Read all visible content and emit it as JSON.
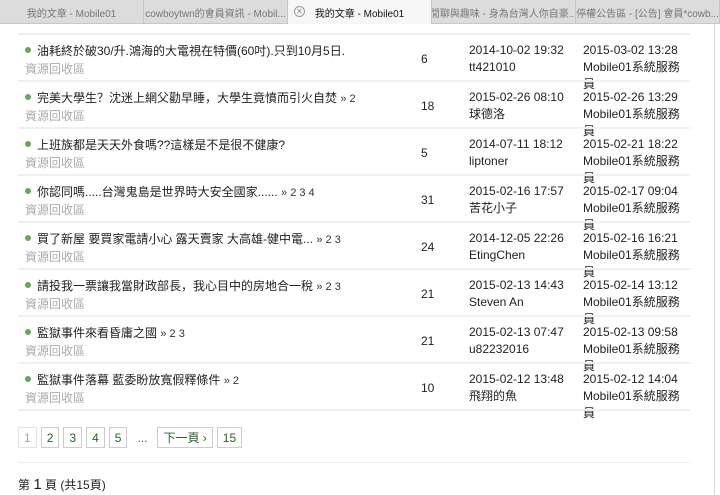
{
  "tabs": [
    {
      "label": "我的文章 - Mobile01"
    },
    {
      "label": "cowboytwn的會員資訊 - Mobil..."
    },
    {
      "label": "我的文章 - Mobile01"
    },
    {
      "label": "閒聊與趣味 - 身為台灣人你自豪..."
    },
    {
      "label": "停權公告區 - [公告] 會員*cowb..."
    }
  ],
  "rows": [
    {
      "title": "油耗終於破30/升.鴻海的大電視在特價(60吋).只到10月5日.",
      "pages": "",
      "forum": "資源回收區",
      "replies": "6",
      "created": "2014-10-02 19:32",
      "author": "tt421010",
      "last": "2015-03-02 13:28",
      "last_by": "Mobile01系統服務員"
    },
    {
      "title": "完美大學生？沈迷上網父勸早睡，大學生竟憤而引火自焚",
      "pages": "» 2",
      "forum": "資源回收區",
      "replies": "18",
      "created": "2015-02-26 08:10",
      "author": "球德洛",
      "last": "2015-02-26 13:29",
      "last_by": "Mobile01系統服務員"
    },
    {
      "title": "上班族都是天天外食嗎??這樣是不是很不健康?",
      "pages": "",
      "forum": "資源回收區",
      "replies": "5",
      "created": "2014-07-11 18:12",
      "author": "liptoner",
      "last": "2015-02-21 18:22",
      "last_by": "Mobile01系統服務員"
    },
    {
      "title": "你認同嗎.....台灣鬼島是世界時大安全國家......",
      "pages": "» 2 3 4",
      "forum": "資源回收區",
      "replies": "31",
      "created": "2015-02-16 17:57",
      "author": "苦花小子",
      "last": "2015-02-17 09:04",
      "last_by": "Mobile01系統服務員"
    },
    {
      "title": "買了新屋 要買家電請小心 露天賣家 大高雄-健中電...",
      "pages": "» 2 3",
      "forum": "資源回收區",
      "replies": "24",
      "created": "2014-12-05 22:26",
      "author": "EtingChen",
      "last": "2015-02-16 16:21",
      "last_by": "Mobile01系統服務員"
    },
    {
      "title": "請投我一票讓我當財政部長，我心目中的房地合一稅",
      "pages": "» 2 3",
      "forum": "資源回收區",
      "replies": "21",
      "created": "2015-02-13 14:43",
      "author": "Steven An",
      "last": "2015-02-14 13:12",
      "last_by": "Mobile01系統服務員"
    },
    {
      "title": "監獄事件來看昏庸之國",
      "pages": "» 2 3",
      "forum": "資源回收區",
      "replies": "21",
      "created": "2015-02-13 07:47",
      "author": "u82232016",
      "last": "2015-02-13 09:58",
      "last_by": "Mobile01系統服務員"
    },
    {
      "title": "監獄事件落幕 藍委盼放寬假釋條件",
      "pages": "» 2",
      "forum": "資源回收區",
      "replies": "10",
      "created": "2015-02-12 13:48",
      "author": "飛翔的魚",
      "last": "2015-02-12 14:04",
      "last_by": "Mobile01系統服務員"
    }
  ],
  "pager": {
    "pages": [
      "1",
      "2",
      "3",
      "4",
      "5"
    ],
    "ellipsis": "...",
    "next": "下一頁 ›",
    "last": "15"
  },
  "page_info": {
    "prefix": "第",
    "current": "1",
    "suffix": "頁 (共15頁)"
  },
  "colors": {
    "dot": "#6aa55e",
    "link": "#2e5d2e"
  }
}
